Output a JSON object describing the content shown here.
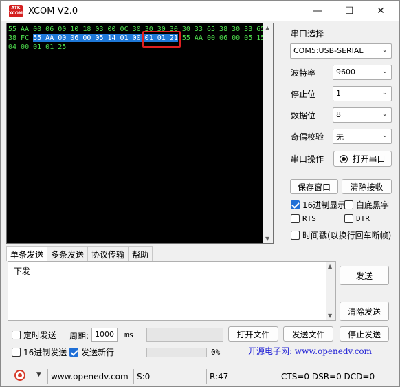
{
  "window": {
    "logo_text": "ATK\nXCOM",
    "title": "XCOM V2.0",
    "min_glyph": "—",
    "max_glyph": "☐",
    "close_glyph": "✕"
  },
  "receive": {
    "line1_a": "55 AA 00 06 00 10 18 03 00 0C 30 30 30 30 30 33 65 38 30 33 65",
    "line2_a": "38 FC ",
    "line2_sel": "55 AA 00 06 00 05 14 01 00 01 01 21",
    "line2_b": " 55 AA 00 06 00 05 15",
    "line3": "04 00 01 01 25"
  },
  "port": {
    "label": "串口选择",
    "value": "COM5:USB-SERIAL"
  },
  "baud": {
    "label": "波特率",
    "value": "9600"
  },
  "stopbits": {
    "label": "停止位",
    "value": "1"
  },
  "databits": {
    "label": "数据位",
    "value": "8"
  },
  "parity": {
    "label": "奇偶校验",
    "value": "无"
  },
  "port_op": {
    "label": "串口操作",
    "button": "打开串口"
  },
  "save_window": "保存窗口",
  "clear_receive": "清除接收",
  "hex_display": {
    "label": "16进制显示",
    "checked": true
  },
  "white_black": {
    "label": "白底黑字",
    "checked": false
  },
  "rts": {
    "label": "RTS",
    "checked": false
  },
  "dtr": {
    "label": "DTR",
    "checked": false
  },
  "timestamp": {
    "label": "时间戳(以换行回车断帧)",
    "checked": false
  },
  "tabs": [
    {
      "label": "单条发送"
    },
    {
      "label": "多条发送"
    },
    {
      "label": "协议传输"
    },
    {
      "label": "帮助"
    }
  ],
  "send": {
    "text": "下发",
    "send_button": "发送",
    "clear_button": "清除发送"
  },
  "timed_send": {
    "label": "定时发送",
    "checked": false
  },
  "period": {
    "label": "周期:",
    "value": "1000",
    "unit": "ms"
  },
  "open_file": "打开文件",
  "send_file": "发送文件",
  "stop_send": "停止发送",
  "hex_send": {
    "label": "16进制发送",
    "checked": false
  },
  "send_newline": {
    "label": "发送新行",
    "checked": true
  },
  "progress": {
    "percent": "0%",
    "value": 0
  },
  "banner": "开源电子网: www.openedv.com",
  "status": {
    "url": "www.openedv.com",
    "sent": "S:0",
    "received": "R:47",
    "lines": "CTS=0 DSR=0 DCD=0"
  }
}
